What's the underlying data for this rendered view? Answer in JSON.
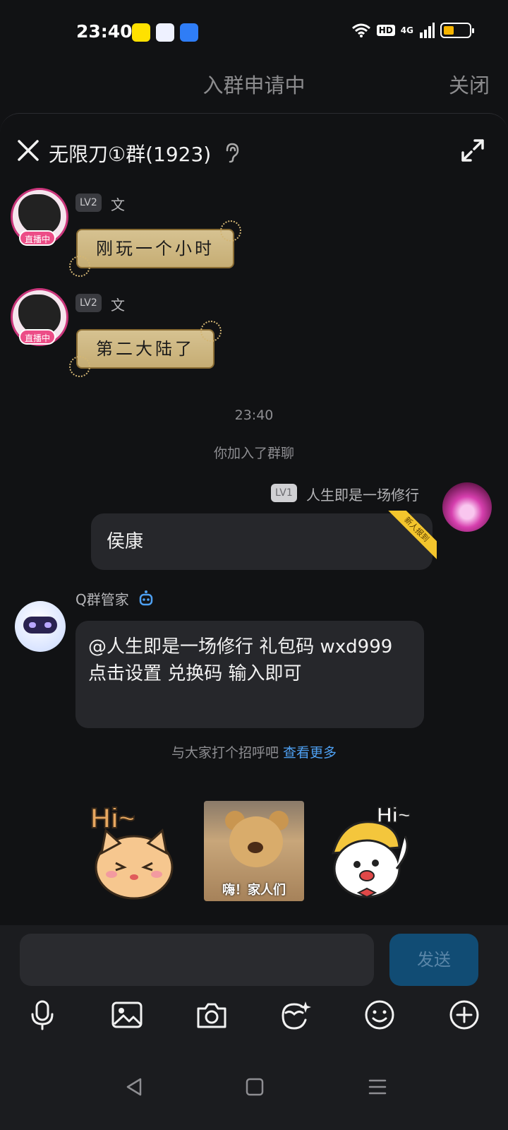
{
  "status_bar": {
    "time": "23:40",
    "hd_label": "HD",
    "network_label": "4G",
    "app_icons": [
      "yy-app-icon",
      "puzzle-app-icon",
      "cloud-app-icon"
    ],
    "accent_battery": "#f5b400"
  },
  "header": {
    "title": "入群申请中",
    "close_label": "关闭"
  },
  "chat": {
    "group_title": "无限刀①群(1923)",
    "messages": [
      {
        "level": "LV2",
        "nickname": "文",
        "live_badge": "直播中",
        "text": "刚玩一个小时"
      },
      {
        "level": "LV2",
        "nickname": "文",
        "live_badge": "直播中",
        "text": "第二大陆了"
      }
    ],
    "timestamp": "23:40",
    "system_notice": "你加入了群聊",
    "my_message": {
      "level": "LV1",
      "nickname": "人生即是一场修行",
      "text": "侯康",
      "ribbon": "新人报到"
    },
    "bot_message": {
      "nickname": "Q群管家",
      "text": "@人生即是一场修行 礼包码 wxd999 点击设置 兑换码 输入即可"
    },
    "greeting": {
      "prompt": "与大家打个招呼吧",
      "link": "查看更多"
    },
    "stickers": [
      {
        "name": "hi-cat-sticker",
        "caption": "Hi~"
      },
      {
        "name": "bear-sticker",
        "caption": "嗨！家人们"
      },
      {
        "name": "hi-duck-sticker",
        "caption": "Hi~"
      }
    ]
  },
  "composer": {
    "input_value": "",
    "send_label": "发送",
    "tools": [
      "microphone-icon",
      "image-icon",
      "camera-icon",
      "sticker-face-icon",
      "emoji-icon",
      "plus-icon"
    ]
  },
  "nav": [
    "back-icon",
    "home-icon",
    "recents-icon"
  ]
}
